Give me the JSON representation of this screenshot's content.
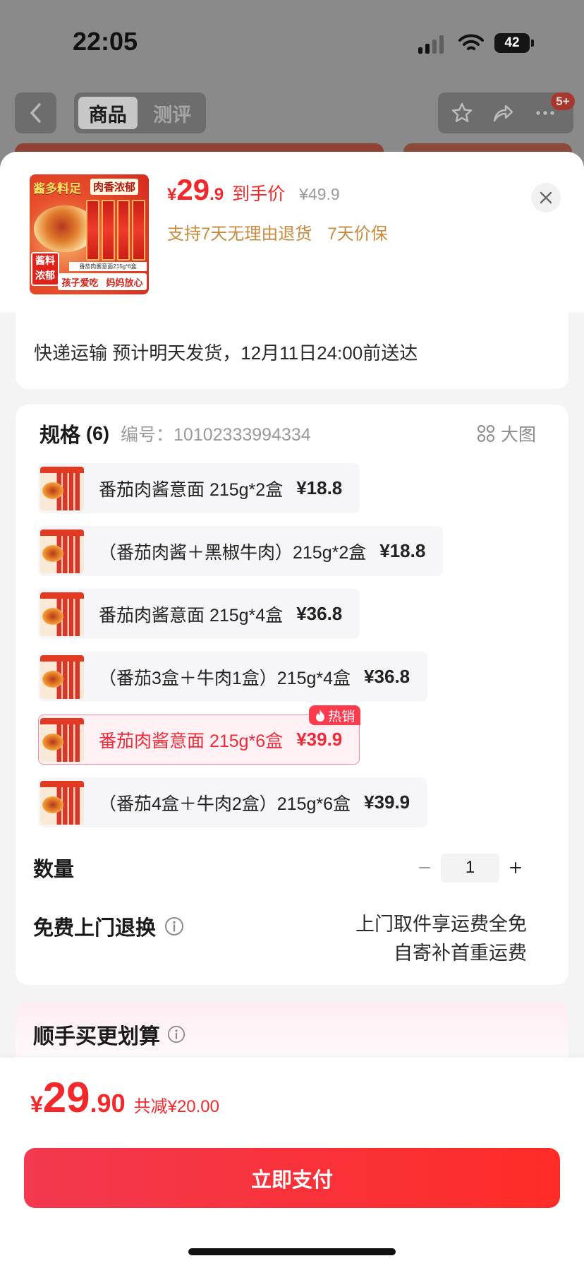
{
  "status_bar": {
    "time": "22:05",
    "battery": "42"
  },
  "nav": {
    "tabs": [
      "商品",
      "测评"
    ],
    "selected_tab": 0,
    "more_badge": "5+"
  },
  "product_header": {
    "thumbnail": {
      "tag_yellow": "酱多料足",
      "tag_white": "肉香浓郁",
      "corner_line1": "酱料",
      "corner_line2": "浓郁",
      "pack_caption": "番茄肉酱意面215g*6盒",
      "slogan_1": "孩子爱吃",
      "slogan_2": "妈妈放心"
    },
    "currency": "¥",
    "price_integer": "29",
    "price_decimal": ".9",
    "price_label": "到手价",
    "original_price": "¥49.9",
    "services": [
      "支持7天无理由退货",
      "7天价保"
    ]
  },
  "delivery": {
    "text": "快递运输 预计明天发货，12月11日24:00前送达"
  },
  "spec": {
    "title": "规格",
    "count": "(6)",
    "code": "编号：10102333994334",
    "big_image_label": "大图",
    "items": [
      {
        "name": "番茄肉酱意面 215g*2盒",
        "price": "¥18.8",
        "selected": false
      },
      {
        "name": "（番茄肉酱＋黑椒牛肉）215g*2盒",
        "price": "¥18.8",
        "selected": false
      },
      {
        "name": "番茄肉酱意面 215g*4盒",
        "price": "¥36.8",
        "selected": false
      },
      {
        "name": "（番茄3盒＋牛肉1盒）215g*4盒",
        "price": "¥36.8",
        "selected": false
      },
      {
        "name": "番茄肉酱意面 215g*6盒",
        "price": "¥39.9",
        "selected": true,
        "badge": "热销"
      },
      {
        "name": "（番茄4盒＋牛肉2盒）215g*6盒",
        "price": "¥39.9",
        "selected": false
      }
    ]
  },
  "quantity": {
    "label": "数量",
    "value": "1"
  },
  "return_service": {
    "label": "免费上门退换",
    "lines": [
      "上门取件享运费全免",
      "自寄补首重运费"
    ]
  },
  "upsell": {
    "title": "顺手买更划算"
  },
  "footer": {
    "currency": "¥",
    "price_integer": "29",
    "price_decimal": ".90",
    "discount": "共减¥20.00",
    "pay_label": "立即支付"
  },
  "colors": {
    "accent": "#f2282b",
    "service": "#c98a3e",
    "selected_bg": "#fff1f3",
    "selected_border": "#f28d99"
  }
}
